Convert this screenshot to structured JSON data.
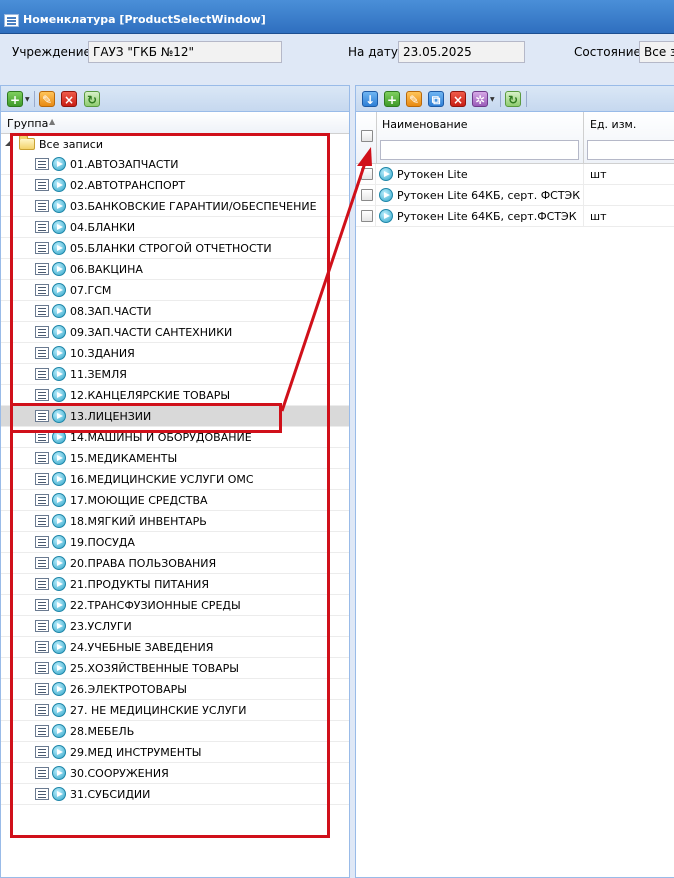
{
  "window": {
    "title": "Номенклатура [ProductSelectWindow]"
  },
  "header": {
    "institution_label": "Учреждение:",
    "institution_value": "ГАУЗ \"ГКБ №12\"",
    "date_label": "На дату:",
    "date_value": "23.05.2025",
    "state_label": "Состояние:",
    "state_value": "Все з"
  },
  "left_panel": {
    "column_header": "Группа",
    "root_label": "Все записи",
    "selected_index": 12,
    "groups": [
      "01.АВТОЗАПЧАСТИ",
      "02.АВТОТРАНСПОРТ",
      "03.БАНКОВСКИЕ ГАРАНТИИ/ОБЕСПЕЧЕНИЕ",
      "04.БЛАНКИ",
      "05.БЛАНКИ СТРОГОЙ ОТЧЕТНОСТИ",
      "06.ВАКЦИНА",
      "07.ГСМ",
      "08.ЗАП.ЧАСТИ",
      "09.ЗАП.ЧАСТИ САНТЕХНИКИ",
      "10.ЗДАНИЯ",
      "11.ЗЕМЛЯ",
      "12.КАНЦЕЛЯРСКИЕ ТОВАРЫ",
      "13.ЛИЦЕНЗИИ",
      "14.МАШИНЫ И ОБОРУДОВАНИЕ",
      "15.МЕДИКАМЕНТЫ",
      "16.МЕДИЦИНСКИЕ УСЛУГИ ОМС",
      "17.МОЮЩИЕ СРЕДСТВА",
      "18.МЯГКИЙ ИНВЕНТАРЬ",
      "19.ПОСУДА",
      "20.ПРАВА ПОЛЬЗОВАНИЯ",
      "21.ПРОДУКТЫ ПИТАНИЯ",
      "22.ТРАНСФУЗИОННЫЕ СРЕДЫ",
      "23.УСЛУГИ",
      "24.УЧЕБНЫЕ ЗАВЕДЕНИЯ",
      "25.ХОЗЯЙСТВЕННЫЕ ТОВАРЫ",
      "26.ЭЛЕКТРОТОВАРЫ",
      "27. НЕ МЕДИЦИНСКИЕ УСЛУГИ",
      "28.МЕБЕЛЬ",
      "29.МЕД ИНСТРУМЕНТЫ",
      "30.СООРУЖЕНИЯ",
      "31.СУБСИДИИ"
    ]
  },
  "right_panel": {
    "col_name": "Наименование",
    "col_unit": "Ед. изм.",
    "rows": [
      {
        "name": "Рутокен Lite",
        "unit": "шт"
      },
      {
        "name": "Рутокен Lite 64КБ, серт. ФСТЭК",
        "unit": ""
      },
      {
        "name": "Рутокен Lite 64КБ, серт.ФСТЭК",
        "unit": "шт"
      }
    ]
  },
  "icons": {
    "window": "window-icon",
    "add": "add-icon",
    "edit": "pencil-icon",
    "delete": "delete-icon",
    "refresh": "refresh-icon",
    "download": "download-icon",
    "copy": "copy-icon",
    "settings": "gear-icon"
  },
  "colors": {
    "annotation": "#d0101a",
    "titlebar": "#2f6fbf",
    "selected_row": "#d9d9d9"
  }
}
